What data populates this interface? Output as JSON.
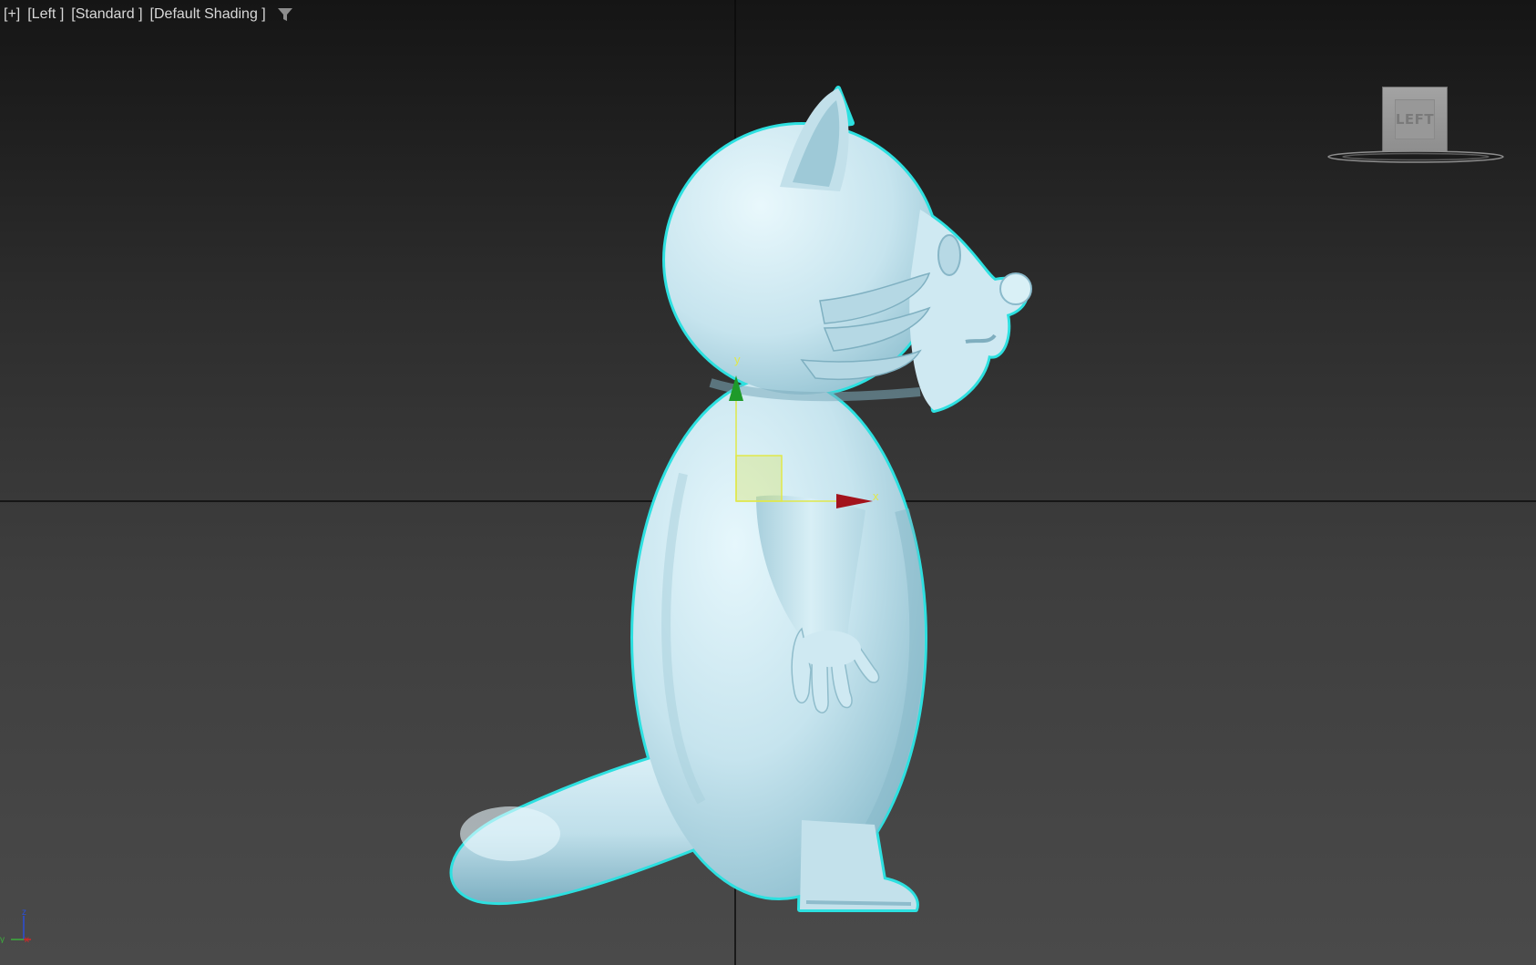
{
  "viewport": {
    "menu_plus": "[+]",
    "menu_view": "[Left ]",
    "menu_mode": "[Standard ]",
    "menu_shading": "[Default Shading ]",
    "filter_icon": "filter-icon"
  },
  "viewcube": {
    "face_label": "LEFT"
  },
  "gizmo": {
    "y_label": "y",
    "x_label": "x"
  },
  "world_axes": {
    "z_label": "z",
    "y_label": "y",
    "x_label": "x"
  },
  "colors": {
    "model_fill": "#c9e7f0",
    "selection_outline": "#2de0e0",
    "grid_line": "#0a0a0a",
    "gizmo_y": "#1e9a2a",
    "gizmo_x": "#a3131c",
    "gizmo_plane": "#d7e25a"
  }
}
